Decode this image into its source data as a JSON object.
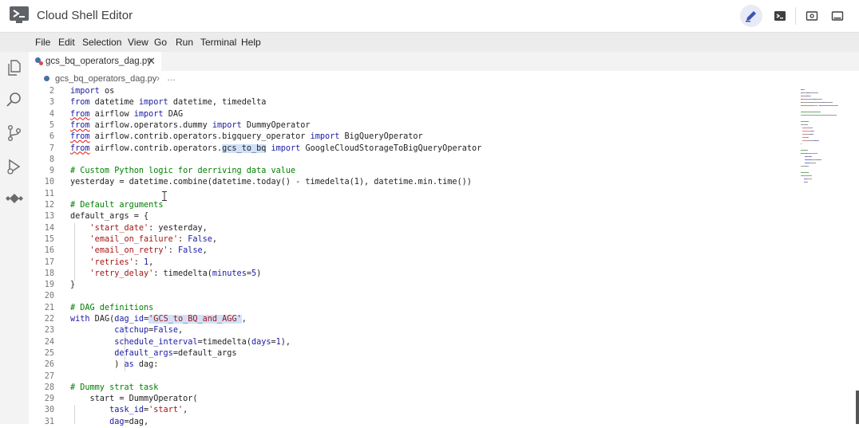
{
  "titlebar": {
    "app_title": "Cloud Shell Editor",
    "buttons": [
      {
        "name": "edit-icon",
        "active": true
      },
      {
        "name": "terminal-icon",
        "active": false
      },
      {
        "name": "preview-icon",
        "active": false
      },
      {
        "name": "layout-icon",
        "active": false
      }
    ]
  },
  "menu": [
    "File",
    "Edit",
    "Selection",
    "View",
    "Go",
    "Run",
    "Terminal",
    "Help"
  ],
  "activity_bar": [
    "files-icon",
    "search-icon",
    "source-control-icon",
    "run-debug-icon",
    "extensions-icon"
  ],
  "tab": {
    "label": "gcs_bq_operators_dag.py",
    "close": "✕"
  },
  "breadcrumb": {
    "file": "gcs_bq_operators_dag.py",
    "separator": "›",
    "more": "…"
  },
  "colors": {
    "keyword": "#1a1aa6",
    "string": "#a31515",
    "comment": "#008000",
    "line_number": "#777777",
    "accent": "#3f51b5"
  },
  "code": [
    {
      "n": "2",
      "tokens": [
        [
          "kw",
          "import"
        ],
        [
          "t",
          " os"
        ]
      ]
    },
    {
      "n": "3",
      "tokens": [
        [
          "kw",
          "from"
        ],
        [
          "t",
          " datetime "
        ],
        [
          "kw",
          "import"
        ],
        [
          "t",
          " datetime, timedelta"
        ]
      ]
    },
    {
      "n": "4",
      "tokens": [
        [
          "kwsq",
          "from"
        ],
        [
          "t",
          " airflow "
        ],
        [
          "kw",
          "import"
        ],
        [
          "t",
          " DAG"
        ]
      ]
    },
    {
      "n": "5",
      "tokens": [
        [
          "kwsq",
          "from"
        ],
        [
          "t",
          " airflow.operators.dummy "
        ],
        [
          "kw",
          "import"
        ],
        [
          "t",
          " DummyOperator"
        ]
      ]
    },
    {
      "n": "6",
      "tokens": [
        [
          "kwsq",
          "from"
        ],
        [
          "t",
          " airflow.contrib.operators.bigquery_operator "
        ],
        [
          "kw",
          "import"
        ],
        [
          "t",
          " BigQueryOperator"
        ]
      ]
    },
    {
      "n": "7",
      "tokens": [
        [
          "kwsq",
          "from"
        ],
        [
          "t",
          " airflow.contrib.operators."
        ],
        [
          "hl",
          "gcs_to_bq"
        ],
        [
          "t",
          " "
        ],
        [
          "kw",
          "import"
        ],
        [
          "t",
          " GoogleCloudStorageToBigQueryOperator"
        ]
      ]
    },
    {
      "n": "8",
      "tokens": []
    },
    {
      "n": "9",
      "tokens": [
        [
          "cm",
          "# Custom Python logic for derriving data value"
        ]
      ]
    },
    {
      "n": "10",
      "tokens": [
        [
          "t",
          "yesterday = datetime.combine(datetime.today() - timedelta(1), datetime.min.time())"
        ]
      ]
    },
    {
      "n": "11",
      "tokens": []
    },
    {
      "n": "12",
      "tokens": [
        [
          "cm",
          "# Default arguments"
        ]
      ]
    },
    {
      "n": "13",
      "tokens": [
        [
          "t",
          "default_args = {"
        ]
      ]
    },
    {
      "n": "14",
      "tokens": [
        [
          "t",
          "    "
        ],
        [
          "str",
          "'start_date'"
        ],
        [
          "t",
          ": yesterday,"
        ]
      ]
    },
    {
      "n": "15",
      "tokens": [
        [
          "t",
          "    "
        ],
        [
          "str",
          "'email_on_failure'"
        ],
        [
          "t",
          ": "
        ],
        [
          "kw",
          "False"
        ],
        [
          "t",
          ","
        ]
      ]
    },
    {
      "n": "16",
      "tokens": [
        [
          "t",
          "    "
        ],
        [
          "str",
          "'email_on_retry'"
        ],
        [
          "t",
          ": "
        ],
        [
          "kw",
          "False"
        ],
        [
          "t",
          ","
        ]
      ]
    },
    {
      "n": "17",
      "tokens": [
        [
          "t",
          "    "
        ],
        [
          "str",
          "'retries'"
        ],
        [
          "t",
          ": "
        ],
        [
          "kw",
          "1"
        ],
        [
          "t",
          ","
        ]
      ]
    },
    {
      "n": "18",
      "tokens": [
        [
          "t",
          "    "
        ],
        [
          "str",
          "'retry_delay'"
        ],
        [
          "t",
          ": timedelta("
        ],
        [
          "kw",
          "minutes"
        ],
        [
          "t",
          "="
        ],
        [
          "kw",
          "5"
        ],
        [
          "t",
          ")"
        ]
      ]
    },
    {
      "n": "19",
      "tokens": [
        [
          "t",
          "}"
        ]
      ]
    },
    {
      "n": "20",
      "tokens": []
    },
    {
      "n": "21",
      "tokens": [
        [
          "cm",
          "# DAG definitions"
        ]
      ]
    },
    {
      "n": "22",
      "tokens": [
        [
          "kw",
          "with"
        ],
        [
          "t",
          " DAG("
        ],
        [
          "kw",
          "dag_id"
        ],
        [
          "t",
          "="
        ],
        [
          "strhl",
          "'GCS_to_BQ_and_AGG'"
        ],
        [
          "t",
          ","
        ]
      ]
    },
    {
      "n": "23",
      "tokens": [
        [
          "t",
          "         "
        ],
        [
          "kw",
          "catchup"
        ],
        [
          "t",
          "="
        ],
        [
          "kw",
          "False"
        ],
        [
          "t",
          ","
        ]
      ]
    },
    {
      "n": "24",
      "tokens": [
        [
          "t",
          "         "
        ],
        [
          "kw",
          "schedule_interval"
        ],
        [
          "t",
          "=timedelta("
        ],
        [
          "kw",
          "days"
        ],
        [
          "t",
          "="
        ],
        [
          "kw",
          "1"
        ],
        [
          "t",
          "),"
        ]
      ]
    },
    {
      "n": "25",
      "tokens": [
        [
          "t",
          "         "
        ],
        [
          "kw",
          "default_args"
        ],
        [
          "t",
          "=default_args"
        ]
      ]
    },
    {
      "n": "26",
      "tokens": [
        [
          "t",
          "         ) "
        ],
        [
          "kw",
          "as"
        ],
        [
          "t",
          " dag:"
        ]
      ]
    },
    {
      "n": "27",
      "tokens": []
    },
    {
      "n": "28",
      "tokens": [
        [
          "cm",
          "# Dummy strat task"
        ]
      ]
    },
    {
      "n": "29",
      "tokens": [
        [
          "t",
          "    start = DummyOperator("
        ]
      ]
    },
    {
      "n": "30",
      "tokens": [
        [
          "t",
          "        "
        ],
        [
          "kw",
          "task_id"
        ],
        [
          "t",
          "="
        ],
        [
          "str",
          "'start'"
        ],
        [
          "t",
          ","
        ]
      ]
    },
    {
      "n": "31",
      "tokens": [
        [
          "t",
          "        "
        ],
        [
          "kw",
          "dag"
        ],
        [
          "t",
          "=dag,"
        ]
      ]
    }
  ]
}
